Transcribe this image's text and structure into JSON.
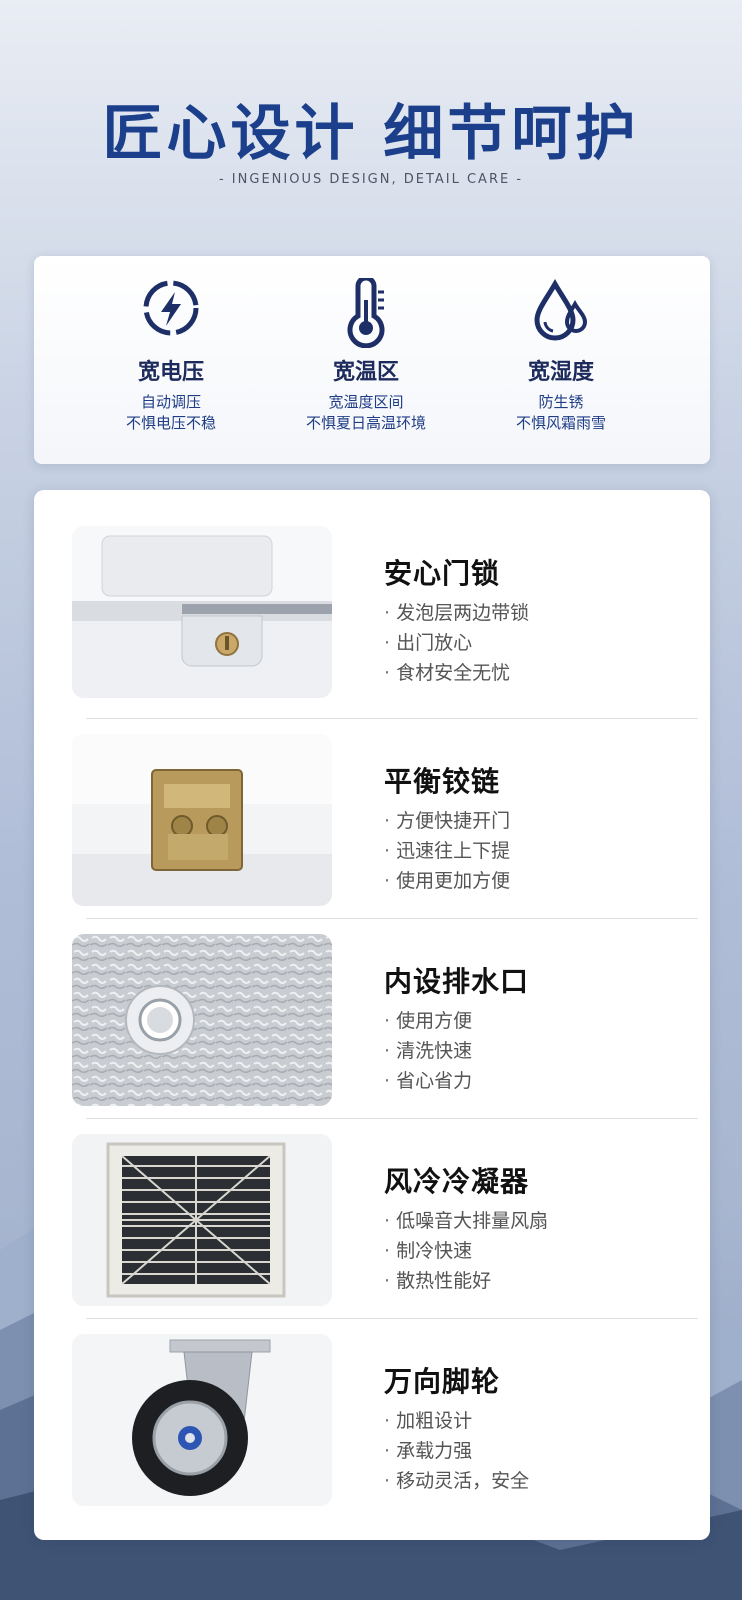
{
  "header": {
    "title": "匠心设计 细节呵护",
    "subtitle": "- INGENIOUS DESIGN, DETAIL CARE -"
  },
  "colors": {
    "brand": "#1b3f8b",
    "icon": "#1d2f66"
  },
  "features": [
    {
      "icon": "voltage-icon",
      "title": "宽电压",
      "line1": "自动调压",
      "line2": "不惧电压不稳"
    },
    {
      "icon": "thermometer-icon",
      "title": "宽温区",
      "line1": "宽温度区间",
      "line2": "不惧夏日高温环境"
    },
    {
      "icon": "water-drops-icon",
      "title": "宽湿度",
      "line1": "防生锈",
      "line2": "不惧风霜雨雪"
    }
  ],
  "details": [
    {
      "image": "door-lock-image",
      "title": "安心门锁",
      "bullets": [
        "发泡层两边带锁",
        "出门放心",
        "食材安全无忧"
      ]
    },
    {
      "image": "hinge-image",
      "title": "平衡铰链",
      "bullets": [
        "方便快捷开门",
        "迅速往上下提",
        "使用更加方便"
      ]
    },
    {
      "image": "drain-outlet-image",
      "title": "内设排水口",
      "bullets": [
        "使用方便",
        "清洗快速",
        "省心省力"
      ]
    },
    {
      "image": "condenser-fan-image",
      "title": "风冷冷凝器",
      "bullets": [
        "低噪音大排量风扇",
        "制冷快速",
        "散热性能好"
      ]
    },
    {
      "image": "caster-wheel-image",
      "title": "万向脚轮",
      "bullets": [
        "加粗设计",
        "承载力强",
        "移动灵活，安全"
      ]
    }
  ]
}
